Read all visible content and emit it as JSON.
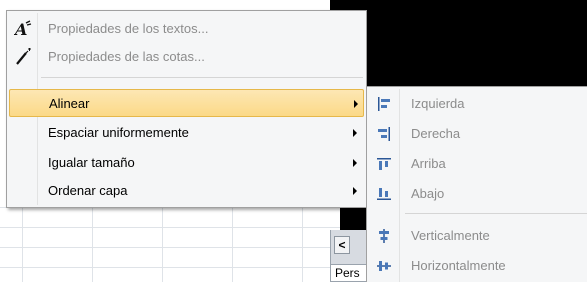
{
  "context_menu": {
    "items": [
      {
        "label": "Propiedades de los textos...",
        "icon": "text-properties-icon",
        "disabled": true
      },
      {
        "label": "Propiedades de las cotas...",
        "icon": "dimension-properties-icon",
        "disabled": true
      },
      {
        "label": "Alinear",
        "has_submenu": true,
        "highlighted": true
      },
      {
        "label": "Espaciar uniformemente",
        "has_submenu": true
      },
      {
        "label": "Igualar tamaño",
        "has_submenu": true
      },
      {
        "label": "Ordenar capa",
        "has_submenu": true
      }
    ]
  },
  "align_submenu": {
    "items": [
      {
        "label": "Izquierda",
        "icon": "align-left-icon",
        "disabled": true
      },
      {
        "label": "Derecha",
        "icon": "align-right-icon",
        "disabled": true
      },
      {
        "label": "Arriba",
        "icon": "align-top-icon",
        "disabled": true
      },
      {
        "label": "Abajo",
        "icon": "align-bottom-icon",
        "disabled": true
      },
      {
        "label": "Verticalmente",
        "icon": "center-vertical-icon",
        "disabled": true
      },
      {
        "label": "Horizontalmente",
        "icon": "center-horizontal-icon",
        "disabled": true
      }
    ]
  },
  "background": {
    "nav_button_label": "<",
    "sheet_tab_label": "Pers"
  },
  "colors": {
    "highlight_top": "#fde7b4",
    "highlight_bottom": "#fbd987",
    "highlight_border": "#e6b84a",
    "menu_bg": "#f5f6f7",
    "disabled_text": "#8c8c8c",
    "icon_blue": "#2b5797"
  }
}
